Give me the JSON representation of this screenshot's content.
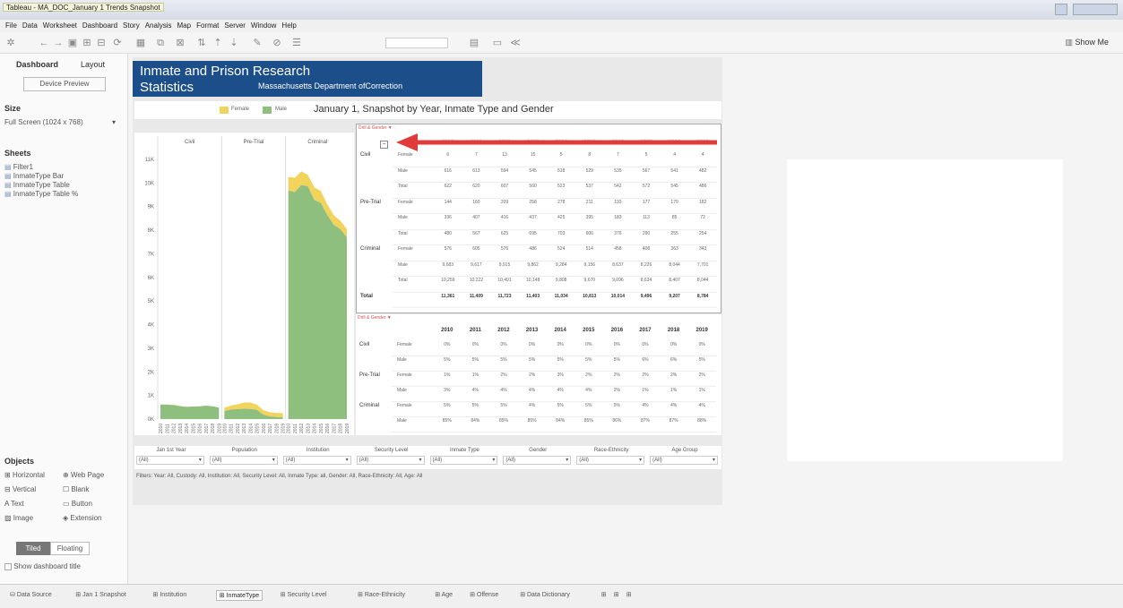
{
  "window": {
    "title": "Tableau - MA_DOC_January 1 Trends Snapshot"
  },
  "menu": [
    "File",
    "Data",
    "Worksheet",
    "Dashboard",
    "Story",
    "Analysis",
    "Map",
    "Format",
    "Server",
    "Window",
    "Help"
  ],
  "toolbar": {
    "show_me": "Show Me"
  },
  "left": {
    "tab_dashboard": "Dashboard",
    "tab_layout": "Layout",
    "device_preview": "Device Preview",
    "size_h": "Size",
    "size_v": "Full Screen (1024 x 768)",
    "sheets_h": "Sheets",
    "sheets": [
      "Filter1",
      "InmateType Bar",
      "InmateType Table",
      "InmateType Table %"
    ],
    "objects_h": "Objects",
    "objects": [
      "Horizontal",
      "Web Page",
      "Vertical",
      "Blank",
      "Text",
      "Button",
      "Image",
      "Extension"
    ],
    "tiled": "Tiled",
    "floating": "Floating",
    "show_title": "Show dashboard title"
  },
  "header": {
    "line1": "Inmate and Prison Research",
    "line2": "Statistics",
    "line3": "Massachusetts Department ofCorrection"
  },
  "legend": {
    "female": "Female",
    "male": "Male",
    "title": "January 1, Snapshot by Year, Inmate Type and Gender"
  },
  "colors": {
    "female": "#f2d45c",
    "male": "#8fbf7f",
    "header": "#1c4f8a",
    "arrow": "#e03a3a"
  },
  "chart_data": {
    "type": "area",
    "panels": [
      "Civil",
      "Pre-Trial",
      "Criminal"
    ],
    "yticks": [
      "0K",
      "1K",
      "2K",
      "3K",
      "4K",
      "5K",
      "6K",
      "7K",
      "8K",
      "9K",
      "10K",
      "11K"
    ],
    "x": [
      "2010",
      "2011",
      "2012",
      "2013",
      "2014",
      "2015",
      "2016",
      "2017",
      "2018",
      "2019"
    ],
    "ylim": [
      0,
      11000
    ],
    "series": [
      {
        "name": "Female",
        "values": {
          "Civil": [
            6,
            7,
            13,
            15,
            5,
            8,
            7,
            5,
            4,
            4
          ],
          "Pre-Trial": [
            144,
            160,
            209,
            258,
            278,
            211,
            193,
            177,
            170,
            182
          ],
          "Criminal": [
            576,
            605,
            576,
            486,
            524,
            514,
            458,
            408,
            363,
            343
          ]
        }
      },
      {
        "name": "Male",
        "values": {
          "Civil": [
            616,
            613,
            594,
            545,
            518,
            529,
            535,
            567,
            541,
            482
          ],
          "Pre-Trial": [
            336,
            407,
            416,
            437,
            425,
            395,
            183,
            113,
            85,
            72
          ],
          "Criminal": [
            9683,
            9617,
            9915,
            9862,
            9284,
            9156,
            8637,
            8226,
            8044,
            7701
          ]
        }
      }
    ]
  },
  "table1": {
    "title": "Drill & Gender ▼",
    "years": [
      "2010",
      "2011",
      "2012",
      "2013",
      "2014",
      "2015",
      "2016",
      "2017",
      "2018",
      "2019"
    ],
    "rows": [
      {
        "group": "Civil",
        "gender": "Female",
        "vals": [
          "6",
          "7",
          "13",
          "15",
          "5",
          "8",
          "7",
          "5",
          "4",
          "4"
        ]
      },
      {
        "group": "",
        "gender": "Male",
        "vals": [
          "616",
          "613",
          "594",
          "545",
          "518",
          "529",
          "535",
          "567",
          "541",
          "482"
        ]
      },
      {
        "group": "",
        "gender": "Total",
        "vals": [
          "622",
          "620",
          "607",
          "560",
          "523",
          "537",
          "542",
          "572",
          "545",
          "486"
        ]
      },
      {
        "group": "Pre-Trial",
        "gender": "Female",
        "vals": [
          "144",
          "160",
          "209",
          "258",
          "278",
          "211",
          "193",
          "177",
          "170",
          "182"
        ]
      },
      {
        "group": "",
        "gender": "Male",
        "vals": [
          "336",
          "407",
          "416",
          "437",
          "425",
          "395",
          "183",
          "113",
          "85",
          "72"
        ]
      },
      {
        "group": "",
        "gender": "Total",
        "vals": [
          "480",
          "567",
          "625",
          "695",
          "703",
          "606",
          "376",
          "290",
          "255",
          "254"
        ]
      },
      {
        "group": "Criminal",
        "gender": "Female",
        "vals": [
          "576",
          "605",
          "576",
          "486",
          "524",
          "514",
          "458",
          "408",
          "363",
          "343"
        ]
      },
      {
        "group": "",
        "gender": "Male",
        "vals": [
          "9,683",
          "9,617",
          "9,915",
          "9,862",
          "9,284",
          "9,156",
          "8,637",
          "8,226",
          "8,044",
          "7,701"
        ]
      },
      {
        "group": "",
        "gender": "Total",
        "vals": [
          "10,259",
          "10,222",
          "10,491",
          "10,148",
          "9,808",
          "9,670",
          "9,096",
          "8,634",
          "8,407",
          "8,044"
        ]
      },
      {
        "group": "Total",
        "gender": "",
        "vals": [
          "11,361",
          "11,409",
          "11,723",
          "11,403",
          "11,034",
          "10,813",
          "10,014",
          "9,496",
          "9,207",
          "8,784"
        ]
      }
    ]
  },
  "table2": {
    "title": "Drill & Gender ▼",
    "years": [
      "2010",
      "2011",
      "2012",
      "2013",
      "2014",
      "2015",
      "2016",
      "2017",
      "2018",
      "2019"
    ],
    "rows": [
      {
        "group": "Civil",
        "gender": "Female",
        "vals": [
          "0%",
          "0%",
          "0%",
          "0%",
          "0%",
          "0%",
          "0%",
          "0%",
          "0%",
          "0%"
        ]
      },
      {
        "group": "",
        "gender": "Male",
        "vals": [
          "5%",
          "5%",
          "5%",
          "5%",
          "5%",
          "5%",
          "5%",
          "6%",
          "6%",
          "5%"
        ]
      },
      {
        "group": "Pre-Trial",
        "gender": "Female",
        "vals": [
          "1%",
          "1%",
          "2%",
          "2%",
          "3%",
          "2%",
          "2%",
          "2%",
          "2%",
          "2%"
        ]
      },
      {
        "group": "",
        "gender": "Male",
        "vals": [
          "3%",
          "4%",
          "4%",
          "4%",
          "4%",
          "4%",
          "2%",
          "1%",
          "1%",
          "1%"
        ]
      },
      {
        "group": "Criminal",
        "gender": "Female",
        "vals": [
          "5%",
          "5%",
          "5%",
          "4%",
          "5%",
          "5%",
          "5%",
          "4%",
          "4%",
          "4%"
        ]
      },
      {
        "group": "",
        "gender": "Male",
        "vals": [
          "85%",
          "84%",
          "85%",
          "85%",
          "84%",
          "85%",
          "86%",
          "87%",
          "87%",
          "88%"
        ]
      }
    ]
  },
  "filters": [
    {
      "label": "Jan 1st Year",
      "value": "(All)"
    },
    {
      "label": "Population",
      "value": "(All)"
    },
    {
      "label": "Institution",
      "value": "(All)"
    },
    {
      "label": "Security Level",
      "value": "(All)"
    },
    {
      "label": "Inmate Type",
      "value": "(All)"
    },
    {
      "label": "Gender",
      "value": "(All)"
    },
    {
      "label": "Race-Ethnicity",
      "value": "(All)"
    },
    {
      "label": "Age Group",
      "value": "(All)"
    }
  ],
  "filter_text": "Filters: Year: All, Custody: All, Institution: All, Security Level: All, Inmate Type: all, Gender: All, Race-Ethnicity: All, Age: All",
  "bottom_tabs": [
    "Data Source",
    "Jan 1 Snapshot",
    "Institution",
    "InmateType",
    "Security Level",
    "Race-Ethnicity",
    "Age",
    "Offense",
    "Data Dictionary"
  ],
  "active_tab": "InmateType"
}
